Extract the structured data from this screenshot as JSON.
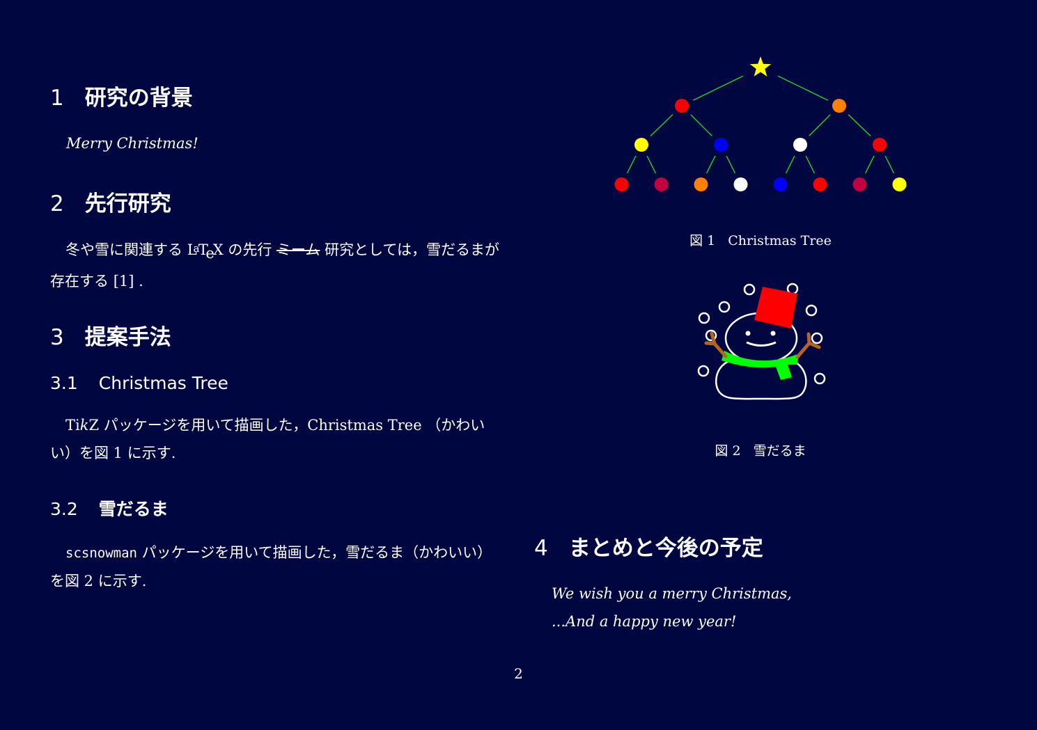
{
  "sections": [
    {
      "num": "1",
      "title": "研究の背景"
    },
    {
      "num": "2",
      "title": "先行研究"
    },
    {
      "num": "3",
      "title": "提案手法"
    },
    {
      "num": "4",
      "title": "まとめと今後の予定"
    }
  ],
  "subsections": [
    {
      "num": "3.1",
      "title": "Christmas Tree"
    },
    {
      "num": "3.2",
      "title": "雪だるま"
    }
  ],
  "background_text": "Merry Christmas!",
  "prior": {
    "before": "冬や雪に関連する ",
    "latex": "LaTeX",
    "after_latex": " の先行 ",
    "struck": "ミーム",
    "after_struck": " 研究としては，雪だるまが存在する ",
    "citation": "[1]",
    "end": " ."
  },
  "tree_para": {
    "tikz": "TikZ",
    "text": " パッケージを用いて描画した，Christmas Tree （かわいい）を図 1 に示す."
  },
  "snow_para": {
    "package": "scsnowman",
    "text": " パッケージを用いて描画した，雪だるま（かわいい）を図 2 に示す."
  },
  "figures": [
    {
      "label": "図 1",
      "caption": "Christmas Tree"
    },
    {
      "label": "図 2",
      "caption": "雪だるま"
    }
  ],
  "closing": [
    "We wish you a merry Christmas,",
    "...And a happy new year!"
  ],
  "page_number": "2",
  "tree": {
    "star_color": "#ffff00",
    "line_color": "#22dd22",
    "levels": [
      [
        "#ff0000",
        "#ff8000"
      ],
      [
        "#ffff00",
        "#0000ff",
        "#ffffff",
        "#ff0000"
      ],
      [
        "#ff0000",
        "#c00040",
        "#ff8000",
        "#ffffff",
        "#0000ff",
        "#ff0000",
        "#c00040",
        "#ffff00"
      ]
    ]
  },
  "snowman": {
    "hat_color": "#ff0000",
    "scarf_color": "#00ff00",
    "arm_color": "#b5651d",
    "body_color": "#ffffff"
  }
}
